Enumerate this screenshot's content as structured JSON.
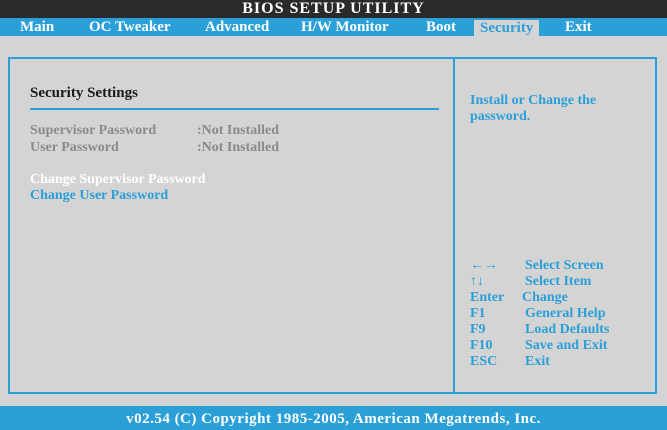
{
  "header": {
    "title": "BIOS SETUP UTILITY"
  },
  "menu": {
    "items": [
      {
        "label": "Main"
      },
      {
        "label": "OC Tweaker"
      },
      {
        "label": "Advanced"
      },
      {
        "label": "H/W Monitor"
      },
      {
        "label": "Boot"
      },
      {
        "label": "Security"
      },
      {
        "label": "Exit"
      }
    ],
    "active": "Security"
  },
  "main": {
    "section_title": "Security Settings",
    "info": [
      {
        "label": "Supervisor Password",
        "value": ":Not Installed"
      },
      {
        "label": "User Password",
        "value": ":Not Installed"
      }
    ],
    "actions": [
      {
        "label": "Change Supervisor Password",
        "selected": true
      },
      {
        "label": "Change User Password",
        "selected": false
      }
    ]
  },
  "help": {
    "text": "Install or Change the password."
  },
  "keys": [
    {
      "key": "←→",
      "action": "Select Screen"
    },
    {
      "key": "↑↓",
      "action": "Select Item"
    },
    {
      "key": "Enter",
      "action": "Change"
    },
    {
      "key": "F1",
      "action": "General Help"
    },
    {
      "key": "F9",
      "action": "Load Defaults"
    },
    {
      "key": "F10",
      "action": "Save and Exit"
    },
    {
      "key": "ESC",
      "action": "Exit"
    }
  ],
  "footer": {
    "copyright": "v02.54 (C) Copyright 1985-2005, American Megatrends, Inc."
  },
  "colors": {
    "accent": "#2ba0d8",
    "background": "#d4d4d4",
    "title_bar": "#2a2a2a",
    "selected_text": "#ffffff",
    "dim_text": "#8a8a8a"
  }
}
